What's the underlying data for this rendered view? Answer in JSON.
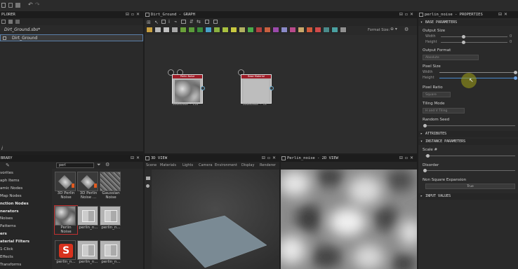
{
  "explorer": {
    "title": "PLORER",
    "package": "Dirt_Ground.sbs*",
    "graph": "Dirt_Ground",
    "bottom_marker": "i"
  },
  "graph": {
    "title": "Dirt_Ground - GRAPH",
    "format_label": "Format Size:",
    "nodes": [
      {
        "header": "Perlin Noise",
        "label": "2048x2048 - L16"
      },
      {
        "header": "Base Material",
        "label": "2048x2048 - C8"
      }
    ],
    "swatch_colors": [
      "#c8a040",
      "#b8b8b8",
      "#c0c0c0",
      "#a8a8a8",
      "#6aa03a",
      "#5a9a3a",
      "#3a8a3a",
      "#48a0c8",
      "#8ab040",
      "#a8c040",
      "#c8c840",
      "#b0b060",
      "#4aaa4a",
      "#b04040",
      "#c86040",
      "#9a4aaa",
      "#8a8ac8",
      "#b84a8a",
      "#c8a86a",
      "#d05a3a",
      "#d04a4a",
      "#4a8a8a",
      "#4aa0a0",
      "#909090"
    ]
  },
  "library": {
    "title": "BRARY",
    "search_value": "perl",
    "categories": [
      {
        "label": "vorites",
        "bold": false
      },
      {
        "label": "aph Items",
        "bold": false
      },
      {
        "label": "amic Nodes",
        "bold": false
      },
      {
        "label": "Map Nodes",
        "bold": false
      },
      {
        "label": "nction Nodes",
        "bold": true
      },
      {
        "label": "nerators",
        "bold": true
      },
      {
        "label": "Noises",
        "bold": false
      },
      {
        "label": "Patterns",
        "bold": false
      },
      {
        "label": "ers",
        "bold": true
      },
      {
        "label": "aterial Filters",
        "bold": true
      },
      {
        "label": "1-Click",
        "bold": false
      },
      {
        "label": "Effects",
        "bold": false
      },
      {
        "label": "Transforms",
        "bold": false
      }
    ],
    "items": [
      {
        "label1": "3D Perlin",
        "label2": "Noise",
        "kind": "noise3d"
      },
      {
        "label1": "3D Perlin",
        "label2": "Noise ...",
        "kind": "noise3d"
      },
      {
        "label1": "Gaussian",
        "label2": "Noise",
        "kind": "gauss"
      },
      {
        "label1": "Perlin",
        "label2": "Noise",
        "kind": "perlin"
      },
      {
        "label1": "perlin_n...",
        "label2": "",
        "kind": "tile"
      },
      {
        "label1": "perlin_n...",
        "label2": "",
        "kind": "tile"
      },
      {
        "label1": "perlin_n...",
        "label2": "",
        "kind": "logo"
      },
      {
        "label1": "perlin_n...",
        "label2": "",
        "kind": "tile"
      },
      {
        "label1": "perlin_n...",
        "label2": "",
        "kind": "tile"
      }
    ]
  },
  "view3d": {
    "title": "3D VIEW",
    "menu": [
      "Scene",
      "Materials",
      "Lights",
      "Camera",
      "Environment",
      "Display",
      "Renderer"
    ]
  },
  "view2d": {
    "title": "Perlin_noise - 2D VIEW"
  },
  "properties": {
    "title": "perlin_noise - PROPERTIES",
    "sections": {
      "base": "BASE PARAMETERS",
      "attributes": "ATTRIBUTES",
      "instance": "INSTANCE PARAMETERS",
      "input": "INPUT VALUES"
    },
    "output_size": {
      "label": "Output Size",
      "width": "Width",
      "height": "Height",
      "wval": "0",
      "hval": "0"
    },
    "output_format": {
      "label": "Output Format",
      "value": "Absolute"
    },
    "pixel_size": {
      "label": "Pixel Size",
      "width": "Width",
      "height": "Height"
    },
    "pixel_ratio": {
      "label": "Pixel Ratio",
      "value": "Square"
    },
    "tiling_mode": {
      "label": "Tiling Mode",
      "value": "H and V Tiling"
    },
    "random_seed": {
      "label": "Random Seed"
    },
    "scale": {
      "label": "Scale #"
    },
    "disorder": {
      "label": "Disorder"
    },
    "non_square": {
      "label": "Non Square Expansion",
      "value": "True"
    }
  }
}
